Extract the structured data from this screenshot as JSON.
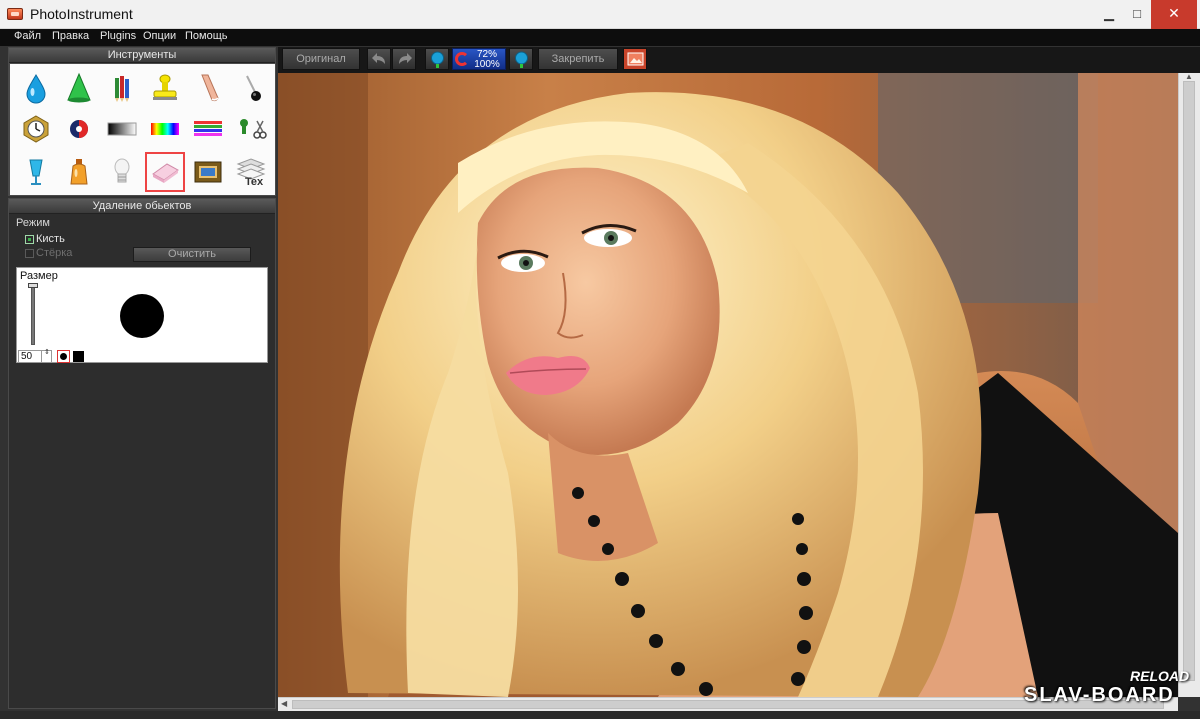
{
  "window": {
    "title": "PhotoInstrument",
    "minimize": "▁",
    "maximize": "□",
    "close": "✕"
  },
  "menu": [
    "Файл",
    "Правка",
    "Plugins",
    "Опции",
    "Помощь"
  ],
  "tools_panel": {
    "title": "Инструменты",
    "tools": [
      "blur-drop-icon",
      "sharpen-cone-icon",
      "pencils-icon",
      "stamp-icon",
      "smudge-finger-icon",
      "brush-pin-icon",
      "clock-icon",
      "color-ball-icon",
      "gradient-bar-icon",
      "rainbow-bar-icon",
      "striped-lines-icon",
      "cut-scissors-icon",
      "glass-icon",
      "perfume-bottle-icon",
      "light-bulb-icon",
      "eraser-icon",
      "picture-frame-icon",
      "text-layers-icon"
    ],
    "active_tool": "eraser-icon",
    "text_tool_label": "Tex"
  },
  "objects_panel": {
    "title": "Удаление обьектов",
    "mode_label": "Режим",
    "brush_label": "Кисть",
    "eraser_label": "Стёрка",
    "brush_checked": true,
    "clear_button": "Очистить",
    "size_label": "Размер",
    "size_value": "50",
    "spinner": "⇕"
  },
  "toolbar": {
    "original": "Оригинал",
    "pin": "Закрепить",
    "zoom_percent": "72%",
    "zoom_actual": "100%"
  },
  "watermark": {
    "line1": "RELOAD",
    "line2": "SLAV-BOARD"
  },
  "colors": {
    "active_outline": "#e44444",
    "check_on": "#39b54a",
    "close_button": "#c83a2c"
  }
}
